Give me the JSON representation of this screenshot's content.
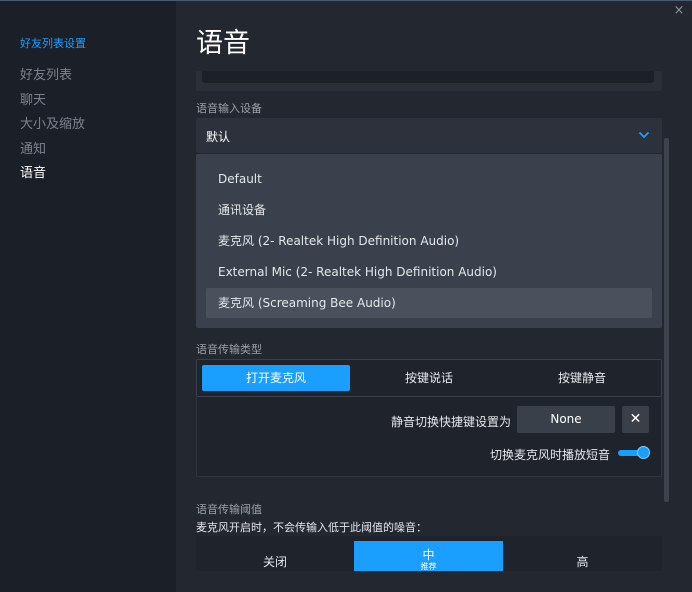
{
  "window": {
    "close_label": "×"
  },
  "sidebar": {
    "section_title": "好友列表设置",
    "items": [
      {
        "label": "好友列表",
        "active": false
      },
      {
        "label": "聊天",
        "active": false
      },
      {
        "label": "大小及缩放",
        "active": false
      },
      {
        "label": "通知",
        "active": false
      },
      {
        "label": "语音",
        "active": true
      }
    ]
  },
  "main": {
    "title": "语音",
    "input_device": {
      "label": "语音输入设备",
      "selected": "默认",
      "options": [
        "Default",
        "通讯设备",
        "麦克风 (2- Realtek High Definition Audio)",
        "External Mic (2- Realtek High Definition Audio)",
        "麦克风 (Screaming Bee Audio)"
      ],
      "hovered_index": 4
    },
    "transmission_type": {
      "label": "语音传输类型",
      "options": [
        "打开麦克风",
        "按键说话",
        "按键静音"
      ],
      "selected_index": 0
    },
    "mute_hotkey": {
      "label": "静音切换快捷键设置为",
      "value": "None",
      "clear_label": "✕"
    },
    "toggle_sound": {
      "label": "切换麦克风时播放短音",
      "enabled": true
    },
    "threshold": {
      "label": "语音传输阈值",
      "description": "麦克风开启时，不会传输入低于此阈值的噪音：",
      "options": [
        {
          "label": "关闭",
          "sub": ""
        },
        {
          "label": "中",
          "sub": "推荐"
        },
        {
          "label": "高",
          "sub": ""
        }
      ],
      "selected_index": 1
    }
  },
  "colors": {
    "accent": "#1a9fff",
    "background": "#1b1f27",
    "panel": "#23272f"
  }
}
